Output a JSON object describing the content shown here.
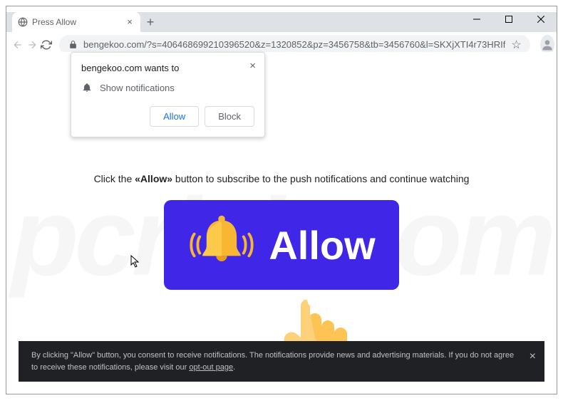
{
  "window": {
    "tab_title": "Press Allow",
    "url": "bengekoo.com/?s=406468699210396520&z=1320852&pz=3456758&tb=3456760&l=SKXjXTI4r73HRIf"
  },
  "permission_dialog": {
    "origin_text": "bengekoo.com wants to",
    "permission_label": "Show notifications",
    "allow_label": "Allow",
    "block_label": "Block"
  },
  "page": {
    "instruction_prefix": "Click the ",
    "instruction_bold": "«Allow»",
    "instruction_suffix": " button to subscribe to the push notifications and continue watching",
    "allow_button_text": "Allow"
  },
  "footer": {
    "text_part1": "By clicking \"Allow\" button, you consent to receive notifications. The notifications provide news and advertising materials. If you do not agree to receive these notifications, please visit our ",
    "link_text": "opt-out page",
    "text_part2": "."
  },
  "watermark_text": "pcrisk.com"
}
